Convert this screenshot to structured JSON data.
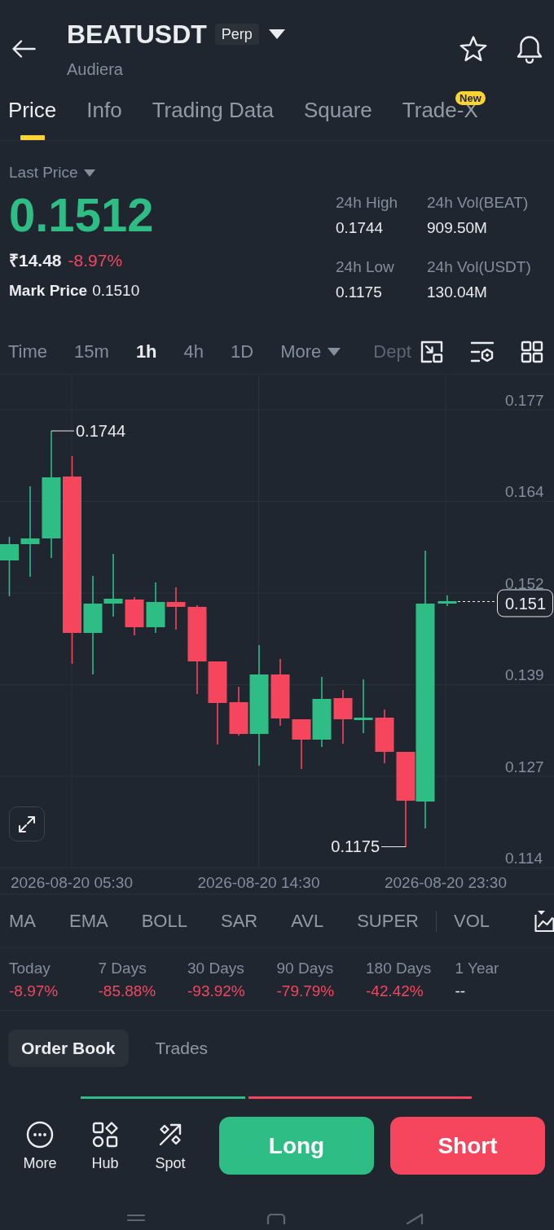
{
  "header": {
    "symbol": "BEATUSDT",
    "contract_type": "Perp",
    "name": "Audiera",
    "favorite": false
  },
  "tabs": [
    {
      "label": "Price",
      "selected": true
    },
    {
      "label": "Info",
      "selected": false
    },
    {
      "label": "Trading Data",
      "selected": false
    },
    {
      "label": "Square",
      "selected": false
    },
    {
      "label": "Trade-X",
      "selected": false,
      "badge": "New"
    }
  ],
  "price": {
    "selector": "Last Price",
    "last": "0.1512",
    "rising": true,
    "fiat": "₹14.48",
    "change": "-8.97%",
    "change_negative": true,
    "mark_label": "Mark Price",
    "mark": "0.1510"
  },
  "stats": [
    {
      "label": "24h High",
      "value": "0.1744"
    },
    {
      "label": "24h Vol(BEAT)",
      "value": "909.50M"
    },
    {
      "label": "24h Low",
      "value": "0.1175"
    },
    {
      "label": "24h Vol(USDT)",
      "value": "130.04M"
    }
  ],
  "intervals": [
    {
      "label": "Time",
      "kind": "option",
      "selected": false
    },
    {
      "label": "15m",
      "kind": "option",
      "selected": false
    },
    {
      "label": "1h",
      "kind": "option",
      "selected": true
    },
    {
      "label": "4h",
      "kind": "option",
      "selected": false
    },
    {
      "label": "1D",
      "kind": "option",
      "selected": false
    },
    {
      "label": "More",
      "kind": "dropdown",
      "selected": false
    },
    {
      "label": "Dept",
      "kind": "faded",
      "selected": false
    }
  ],
  "chart": {
    "y_labels": [
      "0.177",
      "0.164",
      "0.152",
      "0.139",
      "0.127",
      "0.114"
    ],
    "x_labels": [
      "2026-08-20 05:30",
      "2026-08-20 14:30",
      "2026-08-20 23:30"
    ],
    "high_label": "0.1744",
    "low_label": "0.1175",
    "price_tag": "0.151"
  },
  "indicators": {
    "main": [
      "MA",
      "EMA",
      "BOLL",
      "SAR",
      "AVL",
      "SUPER"
    ],
    "sub": [
      "VOL"
    ]
  },
  "performance": [
    {
      "period": "Today",
      "change": "-8.97%",
      "negative": true
    },
    {
      "period": "7 Days",
      "change": "-85.88%",
      "negative": true
    },
    {
      "period": "30 Days",
      "change": "-93.92%",
      "negative": true
    },
    {
      "period": "90 Days",
      "change": "-79.79%",
      "negative": true
    },
    {
      "period": "180 Days",
      "change": "-42.42%",
      "negative": true
    },
    {
      "period": "1 Year",
      "change": "--",
      "negative": false
    }
  ],
  "book_tabs": [
    {
      "label": "Order Book",
      "selected": true
    },
    {
      "label": "Trades",
      "selected": false
    }
  ],
  "depth_ratio": {
    "level": 0.43
  },
  "bottom_bar": {
    "actions": [
      {
        "label": "More",
        "kind": "more"
      },
      {
        "label": "Hub",
        "kind": "hub"
      },
      {
        "label": "Spot",
        "kind": "spot"
      }
    ],
    "trade_buttons": [
      {
        "label": "Long",
        "kind": "buy"
      },
      {
        "label": "Short",
        "kind": "sell"
      }
    ]
  }
}
